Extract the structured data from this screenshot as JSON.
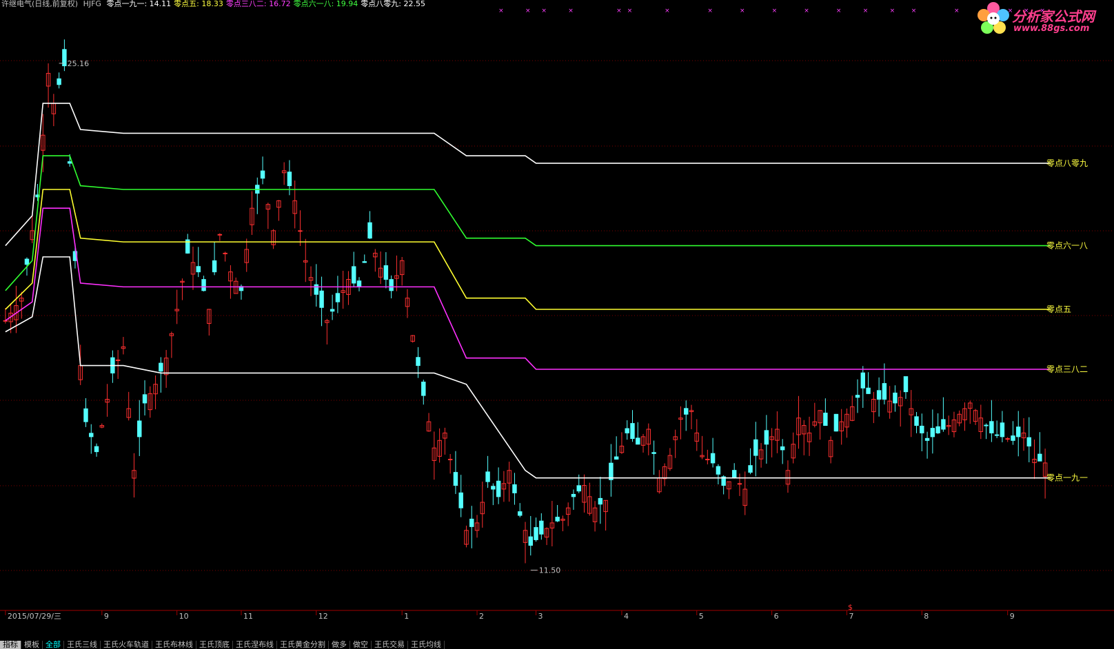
{
  "header": {
    "stock": "许继电气(日线,前复权)",
    "indicator": "HJFG",
    "items": [
      {
        "label": "零点一九一:",
        "value": "14.11",
        "color": "#ffffff"
      },
      {
        "label": "零点五:",
        "value": "18.33",
        "color": "#ffff40"
      },
      {
        "label": "零点三八二:",
        "value": "16.72",
        "color": "#ff40ff"
      },
      {
        "label": "零点六一八:",
        "value": "19.94",
        "color": "#40ff40"
      },
      {
        "label": "零点八零九:",
        "value": "22.55",
        "color": "#ffffff"
      }
    ]
  },
  "logo": {
    "title": "分析家公式网",
    "url": "www.88gs.com"
  },
  "colors": {
    "up": "#ff3030",
    "down": "#54ffff",
    "grid": "#800000",
    "axis": "#a00000"
  },
  "chart_data": {
    "type": "candlestick",
    "ylim": [
      10.5,
      26.5
    ],
    "high_label": "25.16",
    "low_label": "11.50",
    "x_labels": [
      "2015/07/29/三",
      "9",
      "10",
      "11",
      "12",
      "1",
      "2",
      "3",
      "4",
      "5",
      "6",
      "7",
      "8",
      "9"
    ],
    "x_label_positions": [
      0,
      18,
      32,
      44,
      58,
      74,
      88,
      99,
      115,
      129,
      143,
      157,
      171,
      187
    ],
    "total_bars": 195,
    "series": [
      {
        "name": "零点八零九",
        "label": "零点八零九",
        "color": "#ffffff",
        "values": [
          [
            0,
            20.2
          ],
          [
            5,
            21.0
          ],
          [
            7,
            24.0
          ],
          [
            12,
            24.0
          ],
          [
            14,
            23.3
          ],
          [
            22,
            23.2
          ],
          [
            80,
            23.2
          ],
          [
            86,
            22.6
          ],
          [
            97,
            22.6
          ],
          [
            99,
            22.4
          ],
          [
            195,
            22.4
          ]
        ]
      },
      {
        "name": "零点六一八",
        "label": "零点六一八",
        "color": "#30ff30",
        "values": [
          [
            0,
            19.0
          ],
          [
            5,
            19.8
          ],
          [
            7,
            22.6
          ],
          [
            12,
            22.6
          ],
          [
            14,
            21.8
          ],
          [
            22,
            21.7
          ],
          [
            80,
            21.7
          ],
          [
            86,
            20.4
          ],
          [
            97,
            20.4
          ],
          [
            99,
            20.2
          ],
          [
            195,
            20.2
          ]
        ]
      },
      {
        "name": "零点五",
        "label": "零点五",
        "color": "#ffff30",
        "values": [
          [
            0,
            18.5
          ],
          [
            5,
            19.2
          ],
          [
            7,
            21.7
          ],
          [
            12,
            21.7
          ],
          [
            14,
            20.4
          ],
          [
            22,
            20.3
          ],
          [
            80,
            20.3
          ],
          [
            86,
            18.8
          ],
          [
            97,
            18.8
          ],
          [
            99,
            18.5
          ],
          [
            195,
            18.5
          ]
        ]
      },
      {
        "name": "零点三八二",
        "label": "零点三八二",
        "color": "#ff30ff",
        "values": [
          [
            0,
            18.2
          ],
          [
            5,
            18.7
          ],
          [
            7,
            21.2
          ],
          [
            12,
            21.2
          ],
          [
            14,
            19.2
          ],
          [
            22,
            19.1
          ],
          [
            80,
            19.1
          ],
          [
            86,
            17.2
          ],
          [
            97,
            17.2
          ],
          [
            99,
            16.9
          ],
          [
            195,
            16.9
          ]
        ]
      },
      {
        "name": "零点一九一",
        "label": "零点一九一",
        "color": "#ffffff",
        "values": [
          [
            0,
            17.9
          ],
          [
            5,
            18.3
          ],
          [
            7,
            19.9
          ],
          [
            12,
            19.9
          ],
          [
            14,
            17.0
          ],
          [
            22,
            17.0
          ],
          [
            29,
            16.8
          ],
          [
            80,
            16.8
          ],
          [
            86,
            16.5
          ],
          [
            97,
            14.2
          ],
          [
            99,
            14.0
          ],
          [
            195,
            14.0
          ]
        ]
      }
    ],
    "line_labels": [
      {
        "text": "零点八零九",
        "value": 22.4,
        "color": "#ffff40"
      },
      {
        "text": "零点六一八",
        "value": 20.2,
        "color": "#ffff40"
      },
      {
        "text": "零点五",
        "value": 18.5,
        "color": "#ffff40"
      },
      {
        "text": "零点三八二",
        "value": 16.9,
        "color": "#ffff40"
      },
      {
        "text": "零点一九一",
        "value": 14.0,
        "color": "#ffff40"
      }
    ],
    "price_path": [
      [
        0,
        18.2
      ],
      [
        3,
        18.8
      ],
      [
        6,
        21.5
      ],
      [
        8,
        24.8
      ],
      [
        9,
        24.0
      ],
      [
        11,
        25.0
      ],
      [
        13,
        19.8
      ],
      [
        14,
        17.0
      ],
      [
        15,
        15.5
      ],
      [
        17,
        14.7
      ],
      [
        20,
        16.8
      ],
      [
        22,
        17.5
      ],
      [
        24,
        14.2
      ],
      [
        26,
        16.0
      ],
      [
        28,
        16.5
      ],
      [
        30,
        17.2
      ],
      [
        32,
        18.5
      ],
      [
        34,
        20.0
      ],
      [
        36,
        19.5
      ],
      [
        38,
        18.5
      ],
      [
        40,
        20.5
      ],
      [
        42,
        19.5
      ],
      [
        44,
        19.0
      ],
      [
        46,
        21.2
      ],
      [
        48,
        22.0
      ],
      [
        50,
        20.6
      ],
      [
        52,
        22.2
      ],
      [
        54,
        21.4
      ],
      [
        56,
        19.8
      ],
      [
        58,
        18.9
      ],
      [
        60,
        18.2
      ],
      [
        62,
        18.7
      ],
      [
        64,
        19.3
      ],
      [
        66,
        19.1
      ],
      [
        68,
        20.4
      ],
      [
        70,
        19.6
      ],
      [
        72,
        19.0
      ],
      [
        74,
        19.8
      ],
      [
        76,
        17.8
      ],
      [
        78,
        16.2
      ],
      [
        80,
        14.8
      ],
      [
        82,
        15.2
      ],
      [
        84,
        13.8
      ],
      [
        86,
        12.6
      ],
      [
        88,
        12.8
      ],
      [
        90,
        13.9
      ],
      [
        92,
        13.5
      ],
      [
        94,
        14.2
      ],
      [
        96,
        13.0
      ],
      [
        98,
        12.2
      ],
      [
        100,
        12.5
      ],
      [
        102,
        12.8
      ],
      [
        104,
        12.9
      ],
      [
        106,
        13.5
      ],
      [
        108,
        13.8
      ],
      [
        110,
        13.2
      ],
      [
        112,
        13.4
      ],
      [
        114,
        14.5
      ],
      [
        116,
        15.2
      ],
      [
        118,
        14.9
      ],
      [
        120,
        15.3
      ],
      [
        122,
        14.0
      ],
      [
        124,
        14.6
      ],
      [
        126,
        15.6
      ],
      [
        128,
        15.8
      ],
      [
        130,
        14.6
      ],
      [
        132,
        14.4
      ],
      [
        134,
        13.8
      ],
      [
        136,
        14.0
      ],
      [
        138,
        13.7
      ],
      [
        140,
        14.6
      ],
      [
        142,
        14.9
      ],
      [
        144,
        15.3
      ],
      [
        146,
        14.2
      ],
      [
        148,
        15.6
      ],
      [
        150,
        15.2
      ],
      [
        152,
        15.8
      ],
      [
        154,
        15.0
      ],
      [
        156,
        15.5
      ],
      [
        158,
        15.9
      ],
      [
        160,
        16.4
      ],
      [
        162,
        16.1
      ],
      [
        164,
        16.1
      ],
      [
        166,
        16.0
      ],
      [
        168,
        16.3
      ],
      [
        170,
        15.4
      ],
      [
        172,
        15.0
      ],
      [
        174,
        15.2
      ],
      [
        176,
        15.4
      ],
      [
        178,
        15.7
      ],
      [
        180,
        16.0
      ],
      [
        182,
        15.6
      ],
      [
        184,
        15.2
      ],
      [
        186,
        15.1
      ],
      [
        188,
        15.0
      ],
      [
        190,
        15.2
      ],
      [
        192,
        14.5
      ],
      [
        194,
        14.4
      ]
    ],
    "signals": [
      92,
      97,
      100,
      105,
      114,
      116,
      123,
      131,
      137,
      143,
      149,
      155,
      160,
      165,
      169,
      177,
      187,
      190,
      193
    ]
  },
  "tabs": [
    {
      "label": "指标",
      "state": "active"
    },
    {
      "label": "模板",
      "state": ""
    },
    {
      "label": "全部",
      "state": "cur"
    },
    {
      "label": "王氏三线",
      "state": ""
    },
    {
      "label": "王氏火车轨道",
      "state": ""
    },
    {
      "label": "王氏布林线",
      "state": ""
    },
    {
      "label": "王氏顶底",
      "state": ""
    },
    {
      "label": "王氏涅布线",
      "state": ""
    },
    {
      "label": "王氏黄金分割",
      "state": ""
    },
    {
      "label": "做多",
      "state": ""
    },
    {
      "label": "做空",
      "state": ""
    },
    {
      "label": "王氏交易",
      "state": ""
    },
    {
      "label": "王氏均线",
      "state": ""
    }
  ]
}
